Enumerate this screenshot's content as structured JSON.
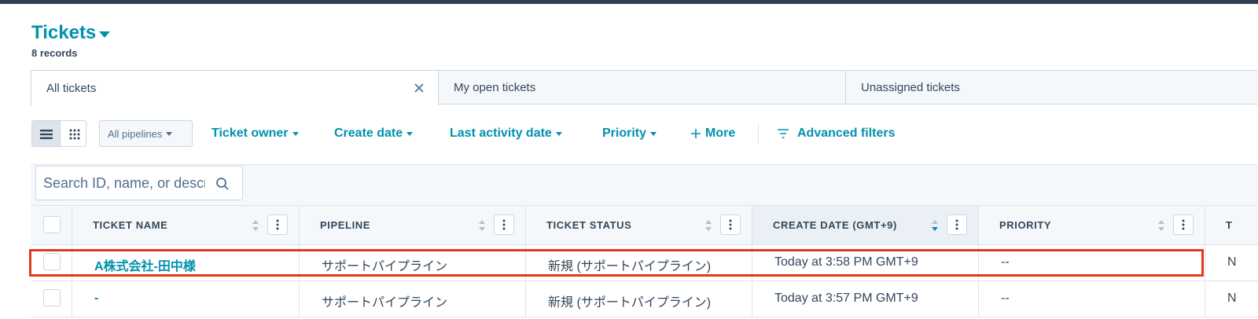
{
  "header": {
    "title": "Tickets",
    "record_count": "8 records"
  },
  "tabs": [
    {
      "label": "All tickets",
      "active": true
    },
    {
      "label": "My open tickets",
      "active": false
    },
    {
      "label": "Unassigned tickets",
      "active": false
    }
  ],
  "filters": {
    "pipelines": "All pipelines",
    "ticket_owner": "Ticket owner",
    "create_date": "Create date",
    "last_activity_date": "Last activity date",
    "priority": "Priority",
    "more": "More",
    "advanced_filters": "Advanced filters"
  },
  "search": {
    "placeholder": "Search ID, name, or description"
  },
  "table": {
    "columns": [
      {
        "label": "TICKET NAME"
      },
      {
        "label": "PIPELINE"
      },
      {
        "label": "TICKET STATUS"
      },
      {
        "label": "CREATE DATE (GMT+9)",
        "sorted": "desc"
      },
      {
        "label": "PRIORITY"
      },
      {
        "label": "T"
      }
    ],
    "rows": [
      {
        "name": "A株式会社-田中様",
        "pipeline": "サポートパイプライン",
        "status": "新規 (サポートパイプライン)",
        "create_date": "Today at 3:58 PM GMT+9",
        "priority": "--",
        "next": "N"
      },
      {
        "name": "-",
        "pipeline": "サポートパイプライン",
        "status": "新規 (サポートパイプライン)",
        "create_date": "Today at 3:57 PM GMT+9",
        "priority": "--",
        "next": "N"
      }
    ]
  },
  "colors": {
    "accent": "#0091ae",
    "text": "#33475b",
    "highlight": "#e03a1e"
  }
}
